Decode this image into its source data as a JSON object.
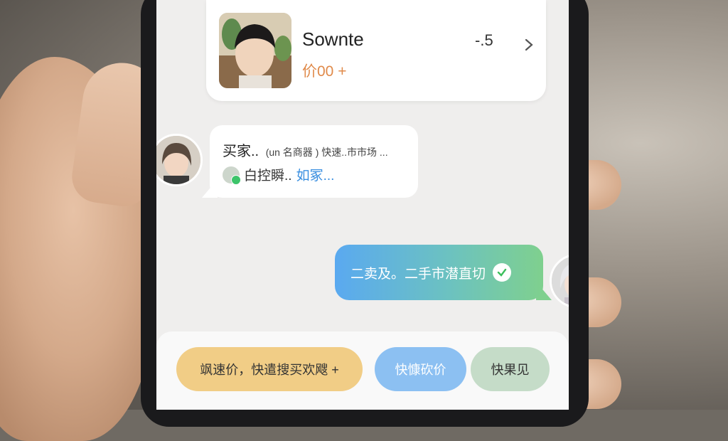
{
  "product": {
    "name": "Sownte",
    "price": "价00 +",
    "count": "-.5"
  },
  "incoming_message": {
    "line1_main": "买家..",
    "line1_detail": "(un 名商器 ) 快速..市市场 ...",
    "line2_text": "白控瞬..",
    "line2_link": "如冢..."
  },
  "outgoing_message": {
    "text": "二卖及。二手市潜直切"
  },
  "quick_replies": [
    {
      "label": "飒速价，快遣搜买欢飕 +"
    },
    {
      "label": "快慷砍价"
    },
    {
      "label": "快果见"
    }
  ],
  "colors": {
    "price": "#e08a4a",
    "link": "#3a8fe0",
    "bubble_gradient_start": "#5aa9f0",
    "bubble_gradient_end": "#7fd08e",
    "chip_yellow": "#f1cd86",
    "chip_blue": "#8cc0f2",
    "chip_green": "#c5dcc8"
  }
}
